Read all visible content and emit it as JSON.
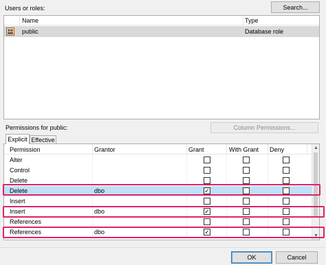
{
  "users": {
    "label": "Users or roles:",
    "search_button": "Search...",
    "columns": [
      "Name",
      "Type"
    ],
    "rows": [
      {
        "name": "public",
        "type": "Database role",
        "icon": "role-icon"
      }
    ]
  },
  "permissions": {
    "label": "Permissions for public:",
    "column_permissions_button": "Column Permissions...",
    "tabs": [
      "Explicit",
      "Effective"
    ],
    "active_tab": "Explicit",
    "columns": [
      "Permission",
      "Grantor",
      "Grant",
      "With Grant",
      "Deny"
    ],
    "rows": [
      {
        "permission": "Alter",
        "grantor": "",
        "grant": false,
        "with_grant": false,
        "deny": false
      },
      {
        "permission": "Control",
        "grantor": "",
        "grant": false,
        "with_grant": false,
        "deny": false
      },
      {
        "permission": "Delete",
        "grantor": "",
        "grant": false,
        "with_grant": false,
        "deny": false
      },
      {
        "permission": "Delete",
        "grantor": "dbo",
        "grant": true,
        "with_grant": false,
        "deny": false,
        "selected": true,
        "highlighted": true
      },
      {
        "permission": "Insert",
        "grantor": "",
        "grant": false,
        "with_grant": false,
        "deny": false
      },
      {
        "permission": "Insert",
        "grantor": "dbo",
        "grant": true,
        "with_grant": false,
        "deny": false,
        "highlighted": true
      },
      {
        "permission": "References",
        "grantor": "",
        "grant": false,
        "with_grant": false,
        "deny": false
      },
      {
        "permission": "References",
        "grantor": "dbo",
        "grant": true,
        "with_grant": false,
        "deny": false,
        "highlighted": true
      }
    ]
  },
  "footer": {
    "ok_label": "OK",
    "cancel_label": "Cancel"
  },
  "colors": {
    "highlight_border": "#e0206a",
    "selected_row": "#bfe0f7",
    "window_bg": "#f0f0f0"
  }
}
